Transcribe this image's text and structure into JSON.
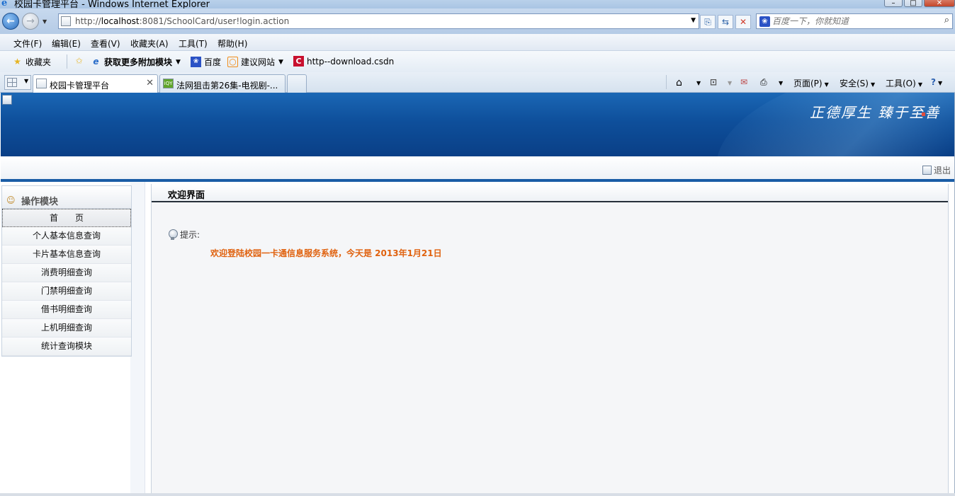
{
  "window": {
    "title": "校园卡管理平台 - Windows Internet Explorer"
  },
  "addressbar": {
    "url_prefix": "http://",
    "url_host": "localhost",
    "url_rest": ":8081/SchoolCard/user!login.action"
  },
  "search": {
    "placeholder": "百度一下，你就知道"
  },
  "menubar": {
    "items": [
      "文件(F)",
      "编辑(E)",
      "查看(V)",
      "收藏夹(A)",
      "工具(T)",
      "帮助(H)"
    ]
  },
  "favorites": {
    "favorites_label": "收藏夹",
    "addons_label": "获取更多附加模块",
    "baidu_label": "百度",
    "suggest_label": "建议网站",
    "csdn_label": "http--download.csdn"
  },
  "tabs": {
    "active": "校园卡管理平台",
    "inactive": "法网狙击第26集-电视剧-..."
  },
  "commandbar": {
    "page": "页面(P)",
    "safety": "安全(S)",
    "tools": "工具(O)"
  },
  "banner": {
    "motto": "正德厚生 臻于至善"
  },
  "header": {
    "logout": "退出"
  },
  "sidebar": {
    "title": "操作模块",
    "items": [
      {
        "label": "首　　页"
      },
      {
        "label": "个人基本信息查询"
      },
      {
        "label": "卡片基本信息查询"
      },
      {
        "label": "消费明细查询"
      },
      {
        "label": "门禁明细查询"
      },
      {
        "label": "借书明细查询"
      },
      {
        "label": "上机明细查询"
      },
      {
        "label": "统计查询模块"
      }
    ]
  },
  "main": {
    "title": "欢迎界面",
    "tip_label": "提示:",
    "welcome_text": "欢迎登陆校园一卡通信息服务系统，今天是  2013年1月21日"
  }
}
